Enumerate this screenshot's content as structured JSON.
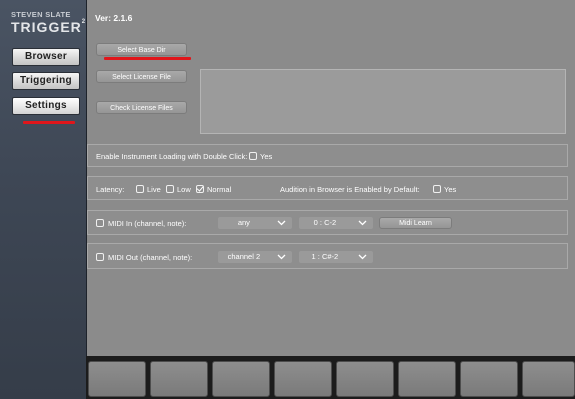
{
  "app": {
    "logo_top": "STEVEN SLATE",
    "logo_main": "TRIGGER",
    "logo_sup": "2",
    "version": "Ver: 2.1.6"
  },
  "sidebar": {
    "items": [
      {
        "label": "Browser",
        "active": false
      },
      {
        "label": "Triggering",
        "active": false
      },
      {
        "label": "Settings",
        "active": true
      }
    ]
  },
  "settings": {
    "select_base_dir": "Select Base Dir",
    "select_license_file": "Select License File",
    "check_license_files": "Check License Files",
    "license_text": "",
    "instrument_loading": {
      "label": "Enable Instrument Loading with Double Click:",
      "option": "Yes",
      "checked": false
    },
    "latency": {
      "label": "Latency:",
      "options": [
        {
          "label": "Live",
          "checked": false
        },
        {
          "label": "Low",
          "checked": false
        },
        {
          "label": "Normal",
          "checked": true
        }
      ]
    },
    "audition": {
      "label": "Audition in Browser is Enabled by Default:",
      "option": "Yes",
      "checked": false
    },
    "midi_in": {
      "label": "MIDI In (channel, note):",
      "checked": false,
      "channel": "any",
      "note": "0 : C-2",
      "learn_label": "Midi Learn"
    },
    "midi_out": {
      "label": "MIDI Out (channel, note):",
      "checked": false,
      "channel": "channel 2",
      "note": "1 : C#-2"
    }
  },
  "colors": {
    "highlight_underline": "#e0161b",
    "panel_bg": "#8b8b8b",
    "sidebar_bg": "#3e4755"
  },
  "pads": {
    "count": 8
  }
}
